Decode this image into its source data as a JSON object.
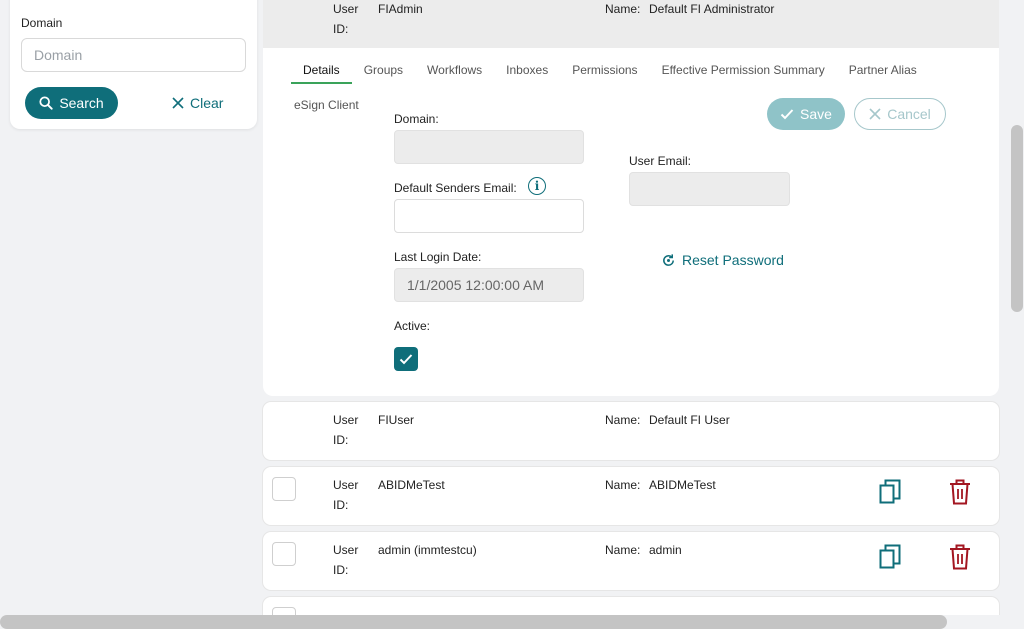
{
  "filter": {
    "domain_label": "Domain",
    "domain_placeholder": "Domain",
    "search_label": "Search",
    "clear_label": "Clear"
  },
  "expanded_user": {
    "user_id_label": "User ID:",
    "user_id": "FIAdmin",
    "name_label": "Name:",
    "name": "Default FI Administrator",
    "tabs": [
      "Details",
      "Groups",
      "Workflows",
      "Inboxes",
      "Permissions",
      "Effective Permission Summary",
      "Partner Alias"
    ],
    "tab_second_line": "eSign Client",
    "active_tab": "Details",
    "save_label": "Save",
    "cancel_label": "Cancel",
    "domain_label": "Domain:",
    "domain_value": "",
    "default_senders_email_label": "Default Senders Email:",
    "default_senders_email_value": "",
    "user_email_label": "User Email:",
    "user_email_value": "",
    "last_login_date_label": "Last Login Date:",
    "last_login_date_value": "1/1/2005 12:00:00 AM",
    "reset_password_label": "Reset Password",
    "active_label": "Active:",
    "active_checked": true
  },
  "users": [
    {
      "user_id_label": "User ID:",
      "user_id": "FIUser",
      "name_label": "Name:",
      "name": "Default FI User",
      "has_actions": false
    },
    {
      "user_id_label": "User ID:",
      "user_id": "ABIDMeTest",
      "name_label": "Name:",
      "name": "ABIDMeTest",
      "has_actions": true
    },
    {
      "user_id_label": "User ID:",
      "user_id": "admin (immtestcu)",
      "name_label": "Name:",
      "name": "admin",
      "has_actions": true
    }
  ],
  "colors": {
    "primary": "#0f6e7a",
    "tab_active_underline": "#3aa35a",
    "delete": "#a31621",
    "save_disabled": "#8fc3c8"
  }
}
